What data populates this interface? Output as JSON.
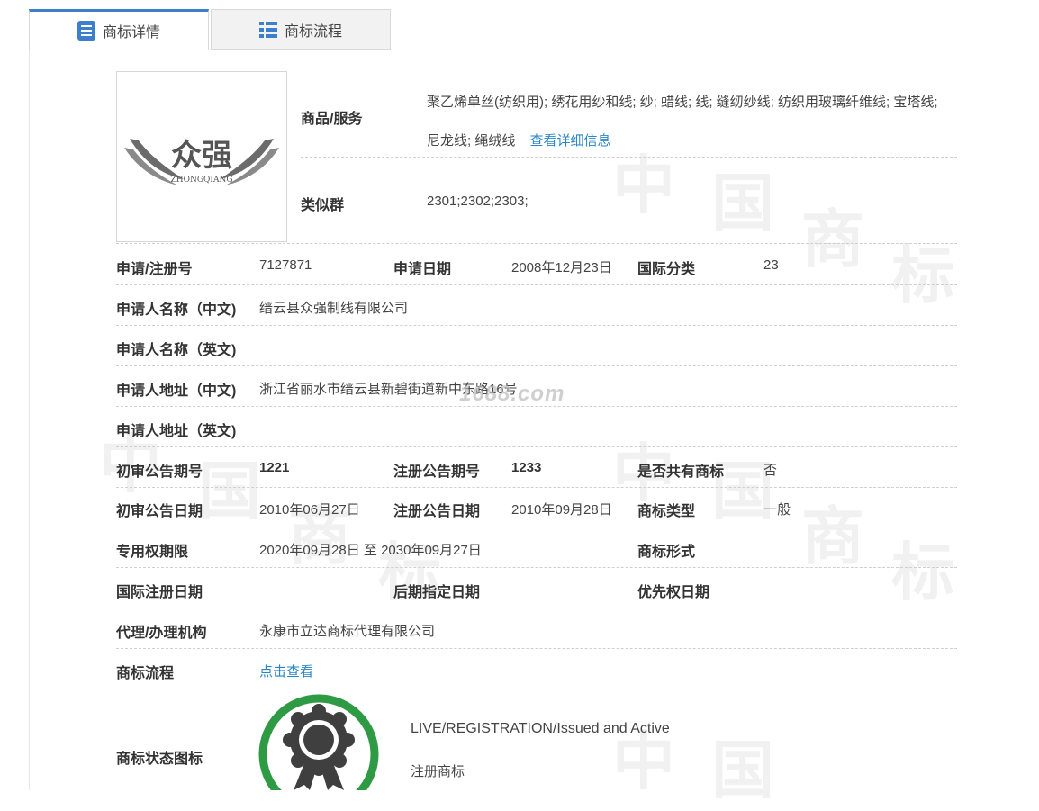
{
  "tabs": [
    {
      "label": "商标详情",
      "icon": "list-doc-icon",
      "active": true
    },
    {
      "label": "商标流程",
      "icon": "list-grid-icon",
      "active": false
    }
  ],
  "logo": {
    "text_cn": "众强",
    "text_en": "ZHONGQIANG"
  },
  "goods": {
    "label": "商品/服务",
    "value": "聚乙烯单丝(纺织用); 绣花用纱和线; 纱; 蜡线; 线; 缝纫纱线; 纺织用玻璃纤维线; 宝塔线; 尼龙线; 绳绒线",
    "more_link": "查看详细信息"
  },
  "similar_group": {
    "label": "类似群",
    "value": "2301;2302;2303;"
  },
  "rows": {
    "reg_no": {
      "label": "申请/注册号",
      "value": "7127871"
    },
    "apply_date": {
      "label": "申请日期",
      "value": "2008年12月23日"
    },
    "intl_class": {
      "label": "国际分类",
      "value": "23"
    },
    "applicant_cn": {
      "label": "申请人名称（中文)",
      "value": "缙云县众强制线有限公司"
    },
    "applicant_en": {
      "label": "申请人名称（英文)",
      "value": ""
    },
    "address_cn": {
      "label": "申请人地址（中文)",
      "value": "浙江省丽水市缙云县新碧街道新中东路16号"
    },
    "address_en": {
      "label": "申请人地址（英文)",
      "value": ""
    },
    "prelim_issue": {
      "label": "初审公告期号",
      "value": "1221"
    },
    "reg_issue": {
      "label": "注册公告期号",
      "value": "1233"
    },
    "shared": {
      "label": "是否共有商标",
      "value": "否"
    },
    "prelim_date": {
      "label": "初审公告日期",
      "value": "2010年06月27日"
    },
    "reg_date": {
      "label": "注册公告日期",
      "value": "2010年09月28日"
    },
    "tm_type": {
      "label": "商标类型",
      "value": "一般"
    },
    "exclusive_period": {
      "label": "专用权期限",
      "value": "2020年09月28日 至 2030年09月27日"
    },
    "tm_form": {
      "label": "商标形式",
      "value": ""
    },
    "intl_reg_date": {
      "label": "国际注册日期",
      "value": ""
    },
    "later_date": {
      "label": "后期指定日期",
      "value": ""
    },
    "priority_date": {
      "label": "优先权日期",
      "value": ""
    },
    "agency": {
      "label": "代理/办理机构",
      "value": "永康市立达商标代理有限公司"
    },
    "flow": {
      "label": "商标流程",
      "value": "点击查看"
    },
    "status_icon": {
      "label": "商标状态图标",
      "status_en": "LIVE/REGISTRATION/Issued and Active",
      "status_cn": "注册商标"
    }
  },
  "watermark": {
    "site": "1688.com",
    "chars": [
      "中",
      "国",
      "商",
      "标"
    ]
  },
  "colors": {
    "accent": "#3d7fcc",
    "link": "#2a86c9",
    "status_ring": "#2e9b44",
    "badge_dark": "#3f3f3f"
  }
}
